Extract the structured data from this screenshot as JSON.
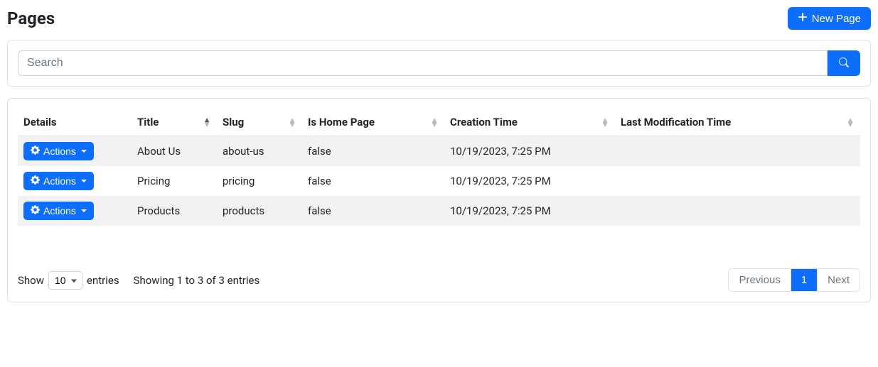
{
  "header": {
    "title": "Pages",
    "new_button": "New Page"
  },
  "search": {
    "placeholder": "Search"
  },
  "table": {
    "columns": {
      "details": "Details",
      "title": "Title",
      "slug": "Slug",
      "is_home_page": "Is Home Page",
      "creation_time": "Creation Time",
      "last_modification_time": "Last Modification Time"
    },
    "actions_label": "Actions",
    "rows": [
      {
        "title": "About Us",
        "slug": "about-us",
        "is_home_page": "false",
        "creation_time": "10/19/2023, 7:25 PM",
        "last_modification_time": ""
      },
      {
        "title": "Pricing",
        "slug": "pricing",
        "is_home_page": "false",
        "creation_time": "10/19/2023, 7:25 PM",
        "last_modification_time": ""
      },
      {
        "title": "Products",
        "slug": "products",
        "is_home_page": "false",
        "creation_time": "10/19/2023, 7:25 PM",
        "last_modification_time": ""
      }
    ]
  },
  "footer": {
    "show_label": "Show",
    "entries_label": "entries",
    "length_value": "10",
    "info": "Showing 1 to 3 of 3 entries",
    "previous": "Previous",
    "current_page": "1",
    "next": "Next"
  }
}
